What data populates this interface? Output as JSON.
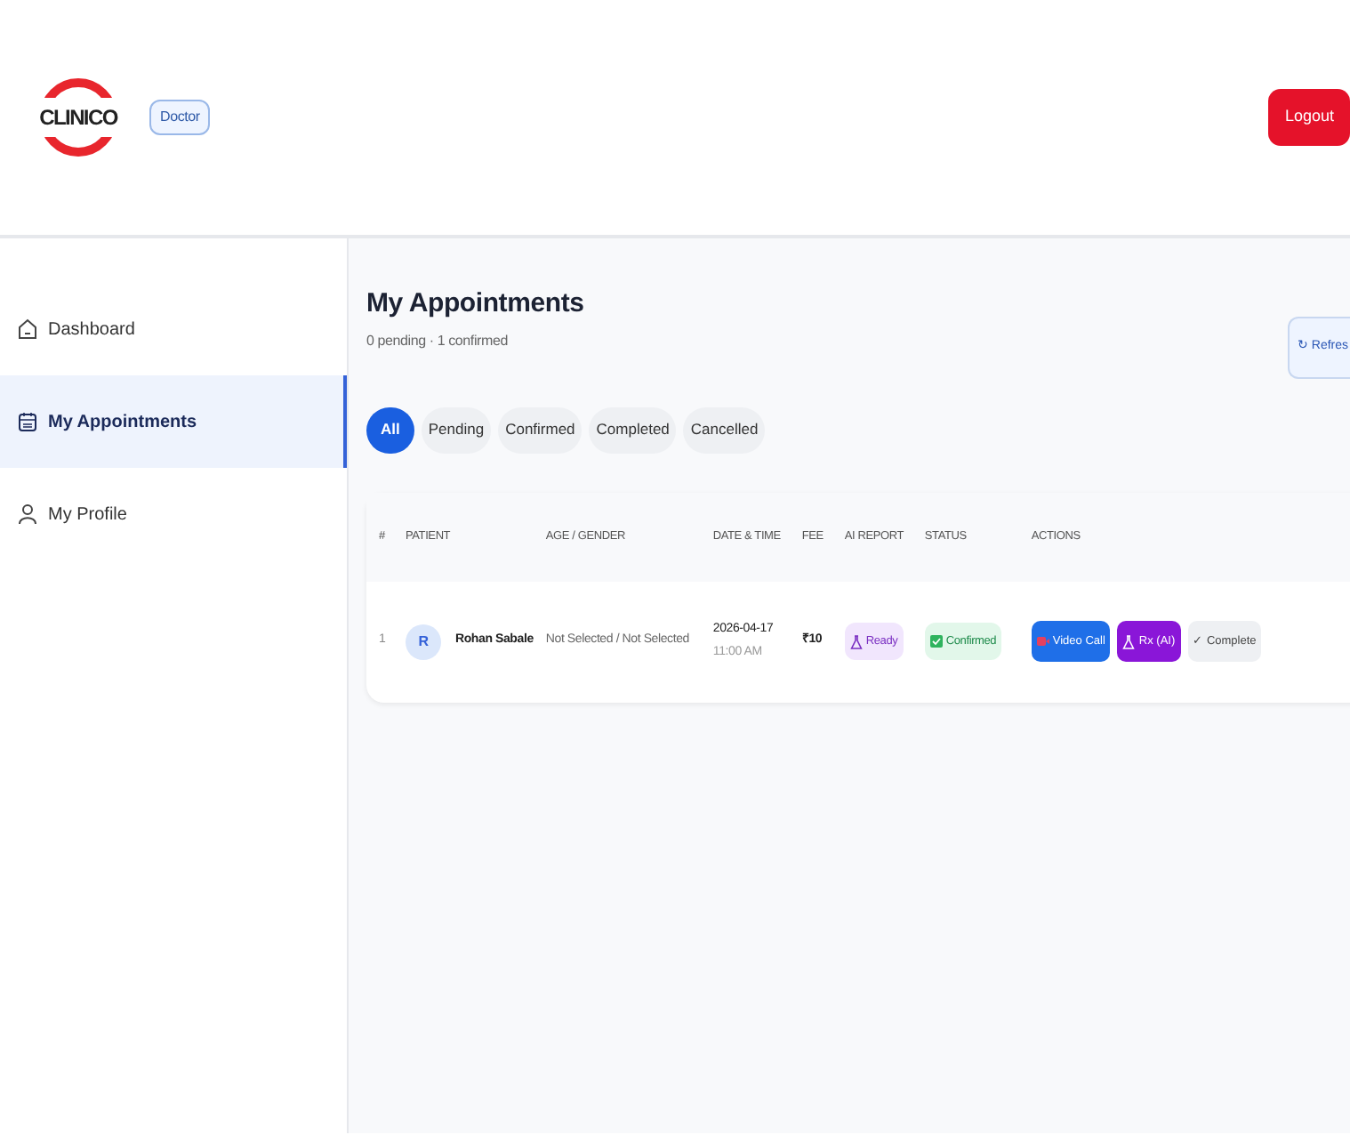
{
  "header": {
    "logo": "CLINICO",
    "role_badge": "Doctor",
    "logout": "Logout"
  },
  "sidebar": {
    "items": [
      {
        "label": "Dashboard",
        "selected": false
      },
      {
        "label": "My Appointments",
        "selected": true
      },
      {
        "label": "My Profile",
        "selected": false
      }
    ]
  },
  "page": {
    "title": "My Appointments",
    "subtitle": "0 pending · 1 confirmed",
    "refresh": "↻ Refres"
  },
  "filters": [
    {
      "label": "All",
      "selected": true
    },
    {
      "label": "Pending",
      "selected": false
    },
    {
      "label": "Confirmed",
      "selected": false
    },
    {
      "label": "Completed",
      "selected": false
    },
    {
      "label": "Cancelled",
      "selected": false
    }
  ],
  "table": {
    "columns": [
      "#",
      "PATIENT",
      "AGE / GENDER",
      "DATE & TIME",
      "FEE",
      "AI REPORT",
      "STATUS",
      "ACTIONS"
    ],
    "rows": [
      {
        "index": "1",
        "avatar": "R",
        "patient": "Rohan Sabale",
        "age_gender": "Not Selected / Not Selected",
        "date": "2026-04-17",
        "time": "11:00 AM",
        "fee": "₹10",
        "ai_report": "Ready",
        "status": "Confirmed",
        "actions": [
          {
            "label": "Video Call",
            "kind": "video"
          },
          {
            "label": "Rx (AI)",
            "kind": "rx"
          },
          {
            "label": "✓ Complete",
            "kind": "complete"
          }
        ]
      }
    ]
  }
}
